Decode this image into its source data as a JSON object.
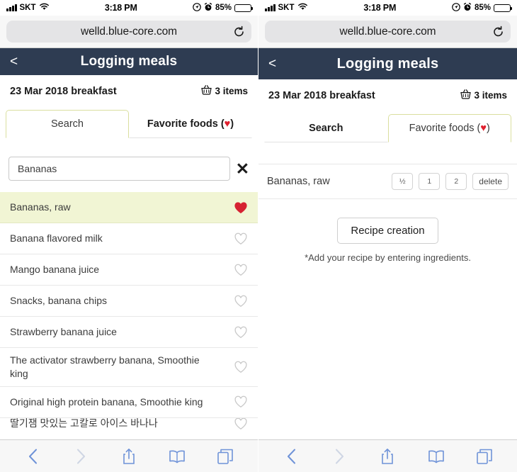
{
  "status_bar": {
    "carrier": "SKT",
    "time": "3:18 PM",
    "battery_percent": "85%",
    "signal_icon": "cellular-bars-icon",
    "wifi_icon": "wifi-icon",
    "location_icon": "location-arrow-icon",
    "alarm_icon": "alarm-clock-icon",
    "battery_icon": "battery-icon"
  },
  "browser": {
    "url": "welld.blue-core.com",
    "reload_icon": "reload-icon",
    "toolbar": {
      "back_label": "‹",
      "forward_label": "›",
      "share_icon": "share-icon",
      "bookmarks_icon": "book-icon",
      "tabs_icon": "tabs-icon"
    }
  },
  "app": {
    "nav": {
      "back_label": "<",
      "title": "Logging meals"
    },
    "meal": {
      "title": "23 Mar 2018 breakfast",
      "basket_icon": "basket-icon",
      "items_count": "3 items"
    },
    "tabs": {
      "search_label": "Search",
      "favorites_label_prefix": "Favorite foods (",
      "favorites_heart": "♥",
      "favorites_label_suffix": ")"
    },
    "colors": {
      "navbar": "#2e3c52",
      "tab_active_border": "#dadf9f",
      "selected_row": "#f1f5d4",
      "heart_filled": "#d62232",
      "heart_outline": "#c8c8c8",
      "toolbar_icon": "#6f93d8"
    }
  },
  "left_panel": {
    "active_tab": "Search",
    "search": {
      "value": "Bananas",
      "placeholder": "Search",
      "clear_label": "✕"
    },
    "results": [
      {
        "name": "Bananas, raw",
        "favorited": true,
        "selected": true
      },
      {
        "name": "Banana flavored milk",
        "favorited": false,
        "selected": false
      },
      {
        "name": "Mango banana juice",
        "favorited": false,
        "selected": false
      },
      {
        "name": "Snacks, banana chips",
        "favorited": false,
        "selected": false
      },
      {
        "name": "Strawberry banana juice",
        "favorited": false,
        "selected": false
      },
      {
        "name": "The activator strawberry banana, Smoothie king",
        "favorited": false,
        "selected": false
      },
      {
        "name": "Original high protein banana, Smoothie king",
        "favorited": false,
        "selected": false
      },
      {
        "name": "딸기잼 맛있는 고칼로 아이스 바나나",
        "favorited": false,
        "selected": false,
        "clipped": true
      }
    ]
  },
  "right_panel": {
    "active_tab": "Favorite foods",
    "favorites": [
      {
        "name": "Bananas, raw",
        "quantities": [
          "½",
          "1",
          "2"
        ],
        "delete_label": "delete"
      }
    ],
    "recipe": {
      "button_label": "Recipe creation",
      "hint": "*Add your recipe by entering ingredients."
    }
  }
}
